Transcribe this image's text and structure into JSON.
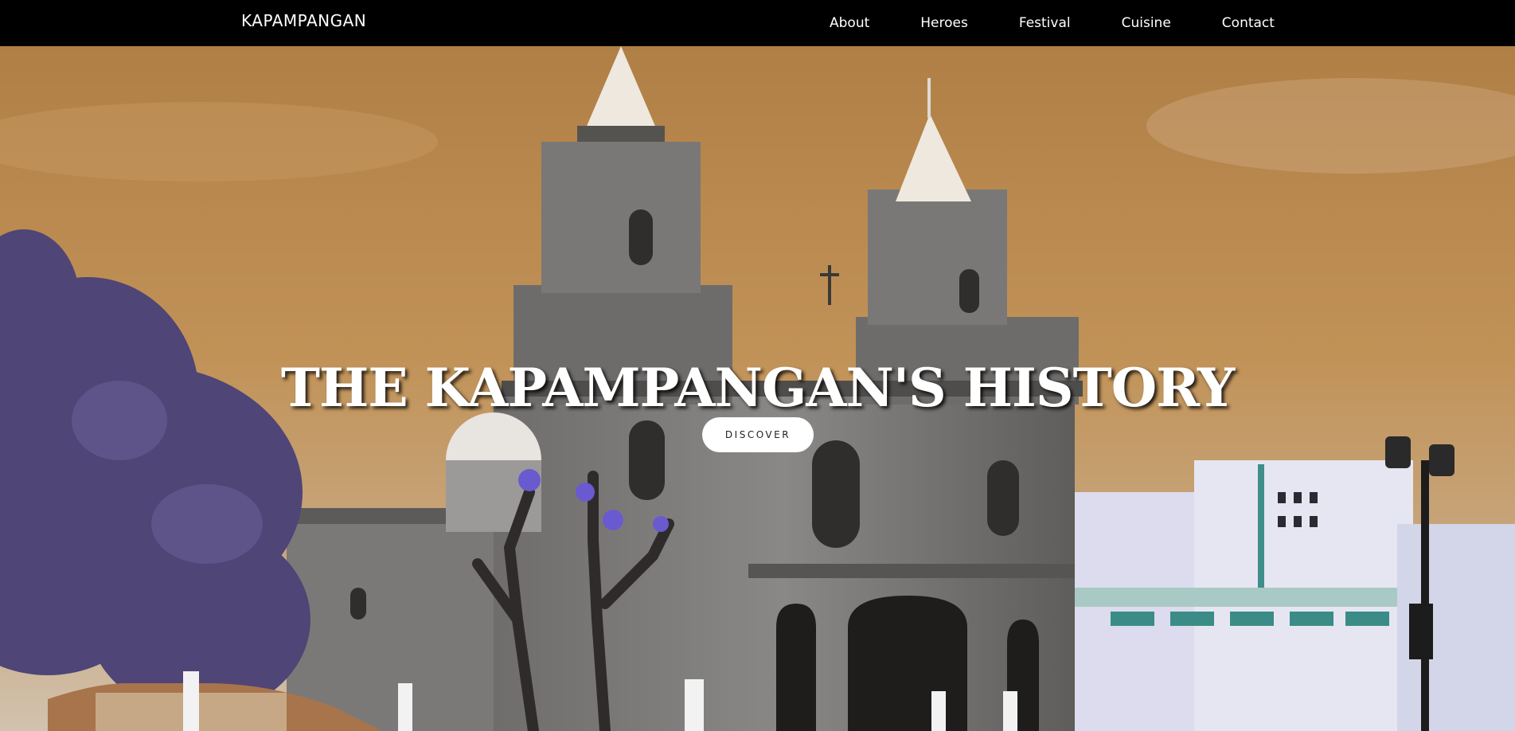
{
  "brand": "KAPAMPANGAN",
  "nav": {
    "items": [
      "About",
      "Heroes",
      "Festival",
      "Cuisine",
      "Contact"
    ]
  },
  "hero": {
    "title": "THE KAPAMPANGAN'S HISTORY",
    "cta_label": "DISCOVER",
    "background_image": "church-facade-photo",
    "colors": {
      "sky": "#c19257",
      "stone": "#7d7b79",
      "tree": "#4f4576",
      "building": "#dcdcee"
    }
  }
}
